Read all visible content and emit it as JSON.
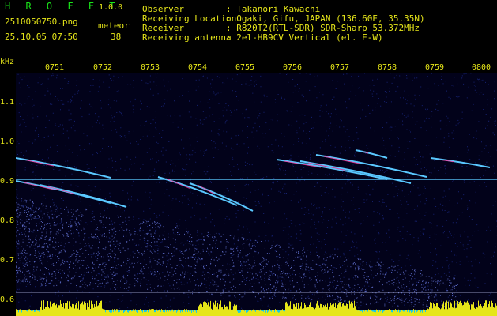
{
  "header": {
    "app_name": "H R O F F T",
    "app_version": "1.0.0",
    "file_name": "2510050750.png",
    "datetime": "25.10.05 07:50",
    "meteor_label": "meteor",
    "meteor_count": "38",
    "info": [
      {
        "key": "Observer",
        "value": ": Takanori Kawachi"
      },
      {
        "key": "Receiving Location",
        "value": ": Ogaki, Gifu, JAPAN (136.60E, 35.35N)"
      },
      {
        "key": "Receiver",
        "value": ": R820T2(RTL-SDR) SDR-Sharp 53.372MHz"
      },
      {
        "key": "Receiving antenna",
        "value": ": 2el-HB9CV Vertical (el. E-W)"
      }
    ]
  },
  "axis": {
    "y_unit": "kHz",
    "y_ticks": [
      "1.1",
      "1.0",
      "0.9",
      "0.8",
      "0.7",
      "0.6"
    ],
    "x_ticks": [
      "0751",
      "0752",
      "0753",
      "0754",
      "0755",
      "0756",
      "0757",
      "0758",
      "0759",
      "0800"
    ]
  },
  "colors": {
    "label": "#e6e619",
    "title": "#19e619",
    "background": "#000000",
    "plot_bg": "#02021a",
    "trace": "#5ac8ff",
    "hot": "#ff3ca0",
    "level_bar": "#e6e619",
    "level_base": "#19c8e6"
  }
}
